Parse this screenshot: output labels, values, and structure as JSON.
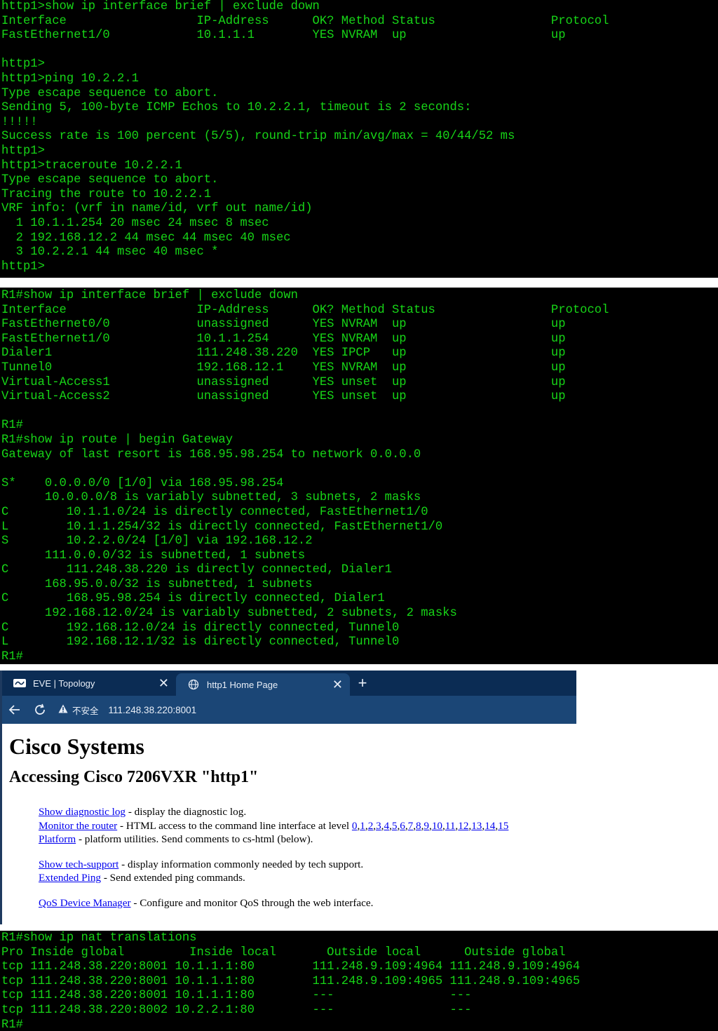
{
  "terminal_top": {
    "color": "#17d517",
    "lines": [
      "http1>show ip interface brief | exclude down",
      "Interface                  IP-Address      OK? Method Status                Protocol",
      "FastEthernet1/0            10.1.1.1        YES NVRAM  up                    up",
      "",
      "http1>",
      "http1>ping 10.2.2.1",
      "Type escape sequence to abort.",
      "Sending 5, 100-byte ICMP Echos to 10.2.2.1, timeout is 2 seconds:",
      "!!!!!",
      "Success rate is 100 percent (5/5), round-trip min/avg/max = 40/44/52 ms",
      "http1>",
      "http1>traceroute 10.2.2.1",
      "Type escape sequence to abort.",
      "Tracing the route to 10.2.2.1",
      "VRF info: (vrf in name/id, vrf out name/id)",
      "  1 10.1.1.254 20 msec 24 msec 8 msec",
      "  2 192.168.12.2 44 msec 44 msec 40 msec",
      "  3 10.2.2.1 44 msec 40 msec *",
      "http1>"
    ]
  },
  "terminal_middle": {
    "lines": [
      "R1#show ip interface brief | exclude down",
      "Interface                  IP-Address      OK? Method Status                Protocol",
      "FastEthernet0/0            unassigned      YES NVRAM  up                    up",
      "FastEthernet1/0            10.1.1.254      YES NVRAM  up                    up",
      "Dialer1                    111.248.38.220  YES IPCP   up                    up",
      "Tunnel0                    192.168.12.1    YES NVRAM  up                    up",
      "Virtual-Access1            unassigned      YES unset  up                    up",
      "Virtual-Access2            unassigned      YES unset  up                    up",
      "",
      "R1#",
      "R1#show ip route | begin Gateway",
      "Gateway of last resort is 168.95.98.254 to network 0.0.0.0",
      "",
      "S*    0.0.0.0/0 [1/0] via 168.95.98.254",
      "      10.0.0.0/8 is variably subnetted, 3 subnets, 2 masks",
      "C        10.1.1.0/24 is directly connected, FastEthernet1/0",
      "L        10.1.1.254/32 is directly connected, FastEthernet1/0",
      "S        10.2.2.0/24 [1/0] via 192.168.12.2",
      "      111.0.0.0/32 is subnetted, 1 subnets",
      "C        111.248.38.220 is directly connected, Dialer1",
      "      168.95.0.0/32 is subnetted, 1 subnets",
      "C        168.95.98.254 is directly connected, Dialer1",
      "      192.168.12.0/24 is variably subnetted, 2 subnets, 2 masks",
      "C        192.168.12.0/24 is directly connected, Tunnel0",
      "L        192.168.12.1/32 is directly connected, Tunnel0",
      "R1#"
    ]
  },
  "browser": {
    "tabs": [
      {
        "title": "EVE | Topology",
        "icon": "eve-logo-icon",
        "active": false
      },
      {
        "title": "http1 Home Page",
        "icon": "globe-icon",
        "active": true
      }
    ],
    "new_tab": "+",
    "close_glyph": "✕",
    "security_label": "不安全",
    "url": "111.248.38.220:8001",
    "page": {
      "title": "Cisco Systems",
      "subtitle": "Accessing Cisco 7206VXR \"http1\"",
      "links": {
        "diag_link": "Show diagnostic log",
        "diag_desc": " - display the diagnostic log.",
        "monitor_link": "Monitor the router",
        "monitor_desc": " - HTML access to the command line interface at level ",
        "levels": [
          "0",
          "1",
          "2",
          "3",
          "4",
          "5",
          "6",
          "7",
          "8",
          "9",
          "10",
          "11",
          "12",
          "13",
          "14",
          "15"
        ],
        "platform_link": "Platform",
        "platform_desc": " - platform utilities. Send comments to cs-html (below).",
        "techsupport_link": "Show tech-support",
        "techsupport_desc": " - display information commonly needed by tech support.",
        "ping_link": "Extended Ping",
        "ping_desc": " - Send extended ping commands.",
        "qos_link": "QoS Device Manager",
        "qos_desc": " - Configure and monitor QoS through the web interface."
      }
    },
    "colors": {
      "tabbar": "#0b2c54",
      "active_tab": "#1b4676",
      "link": "#0000ee"
    }
  },
  "terminal_bottom": {
    "lines": [
      "R1#show ip nat translations",
      "Pro Inside global         Inside local       Outside local      Outside global",
      "tcp 111.248.38.220:8001 10.1.1.1:80        111.248.9.109:4964 111.248.9.109:4964",
      "tcp 111.248.38.220:8001 10.1.1.1:80        111.248.9.109:4965 111.248.9.109:4965",
      "tcp 111.248.38.220:8001 10.1.1.1:80        ---                ---",
      "tcp 111.248.38.220:8002 10.2.2.1:80        ---                ---",
      "R1#"
    ]
  }
}
